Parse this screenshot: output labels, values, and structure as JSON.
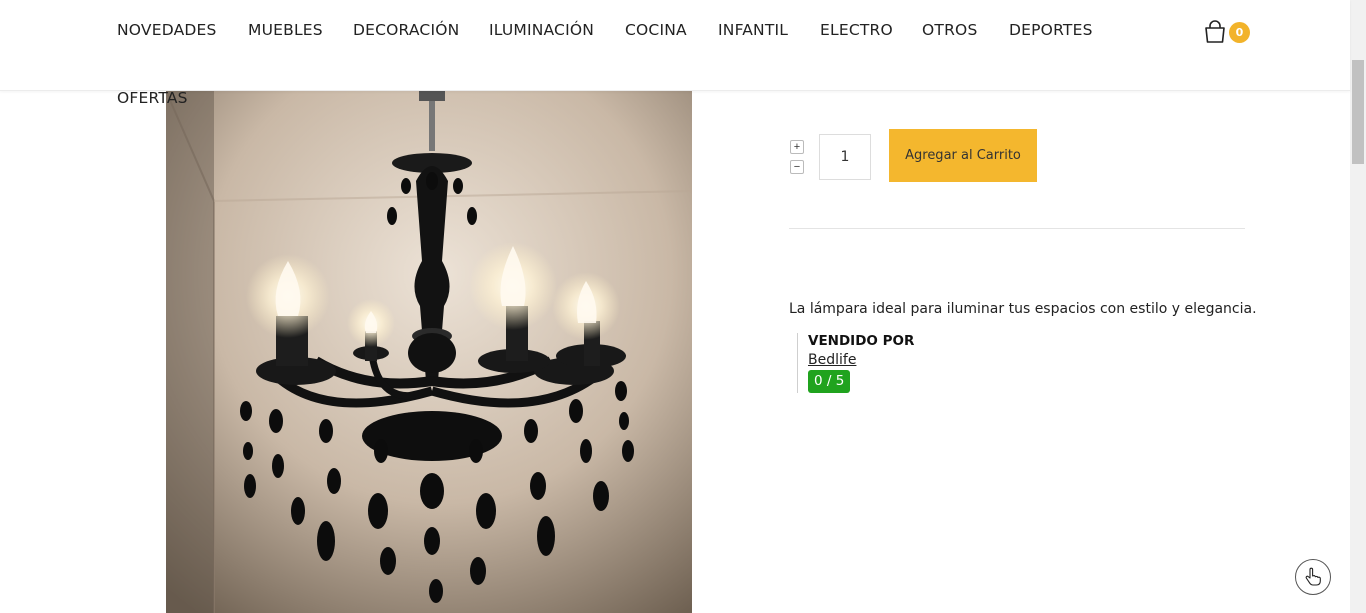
{
  "nav": {
    "items": [
      {
        "label": "NOVEDADES"
      },
      {
        "label": "MUEBLES"
      },
      {
        "label": "DECORACIÓN"
      },
      {
        "label": "ILUMINACIÓN"
      },
      {
        "label": "COCINA"
      },
      {
        "label": "INFANTIL"
      },
      {
        "label": "ELECTRO"
      },
      {
        "label": "OTROS"
      },
      {
        "label": "DEPORTES"
      },
      {
        "label": "OFERTAS"
      }
    ]
  },
  "cart": {
    "count": "0",
    "icon": "shopping-bag-icon",
    "badge_color": "#f2b32a"
  },
  "product": {
    "image_icon": "chandelier-photo",
    "quantity": "1",
    "increment_label": "+",
    "decrement_label": "−",
    "add_to_cart_label": "Agregar al Carrito",
    "add_to_cart_color": "#f4b72e",
    "description": "La lámpara ideal para iluminar tus espacios con estilo y elegancia."
  },
  "vendor": {
    "title": "VENDIDO POR",
    "name": "Bedlife",
    "rating": "0 / 5",
    "rating_color": "#20a31e"
  },
  "floating_button": {
    "icon": "hand-pointer-icon"
  }
}
